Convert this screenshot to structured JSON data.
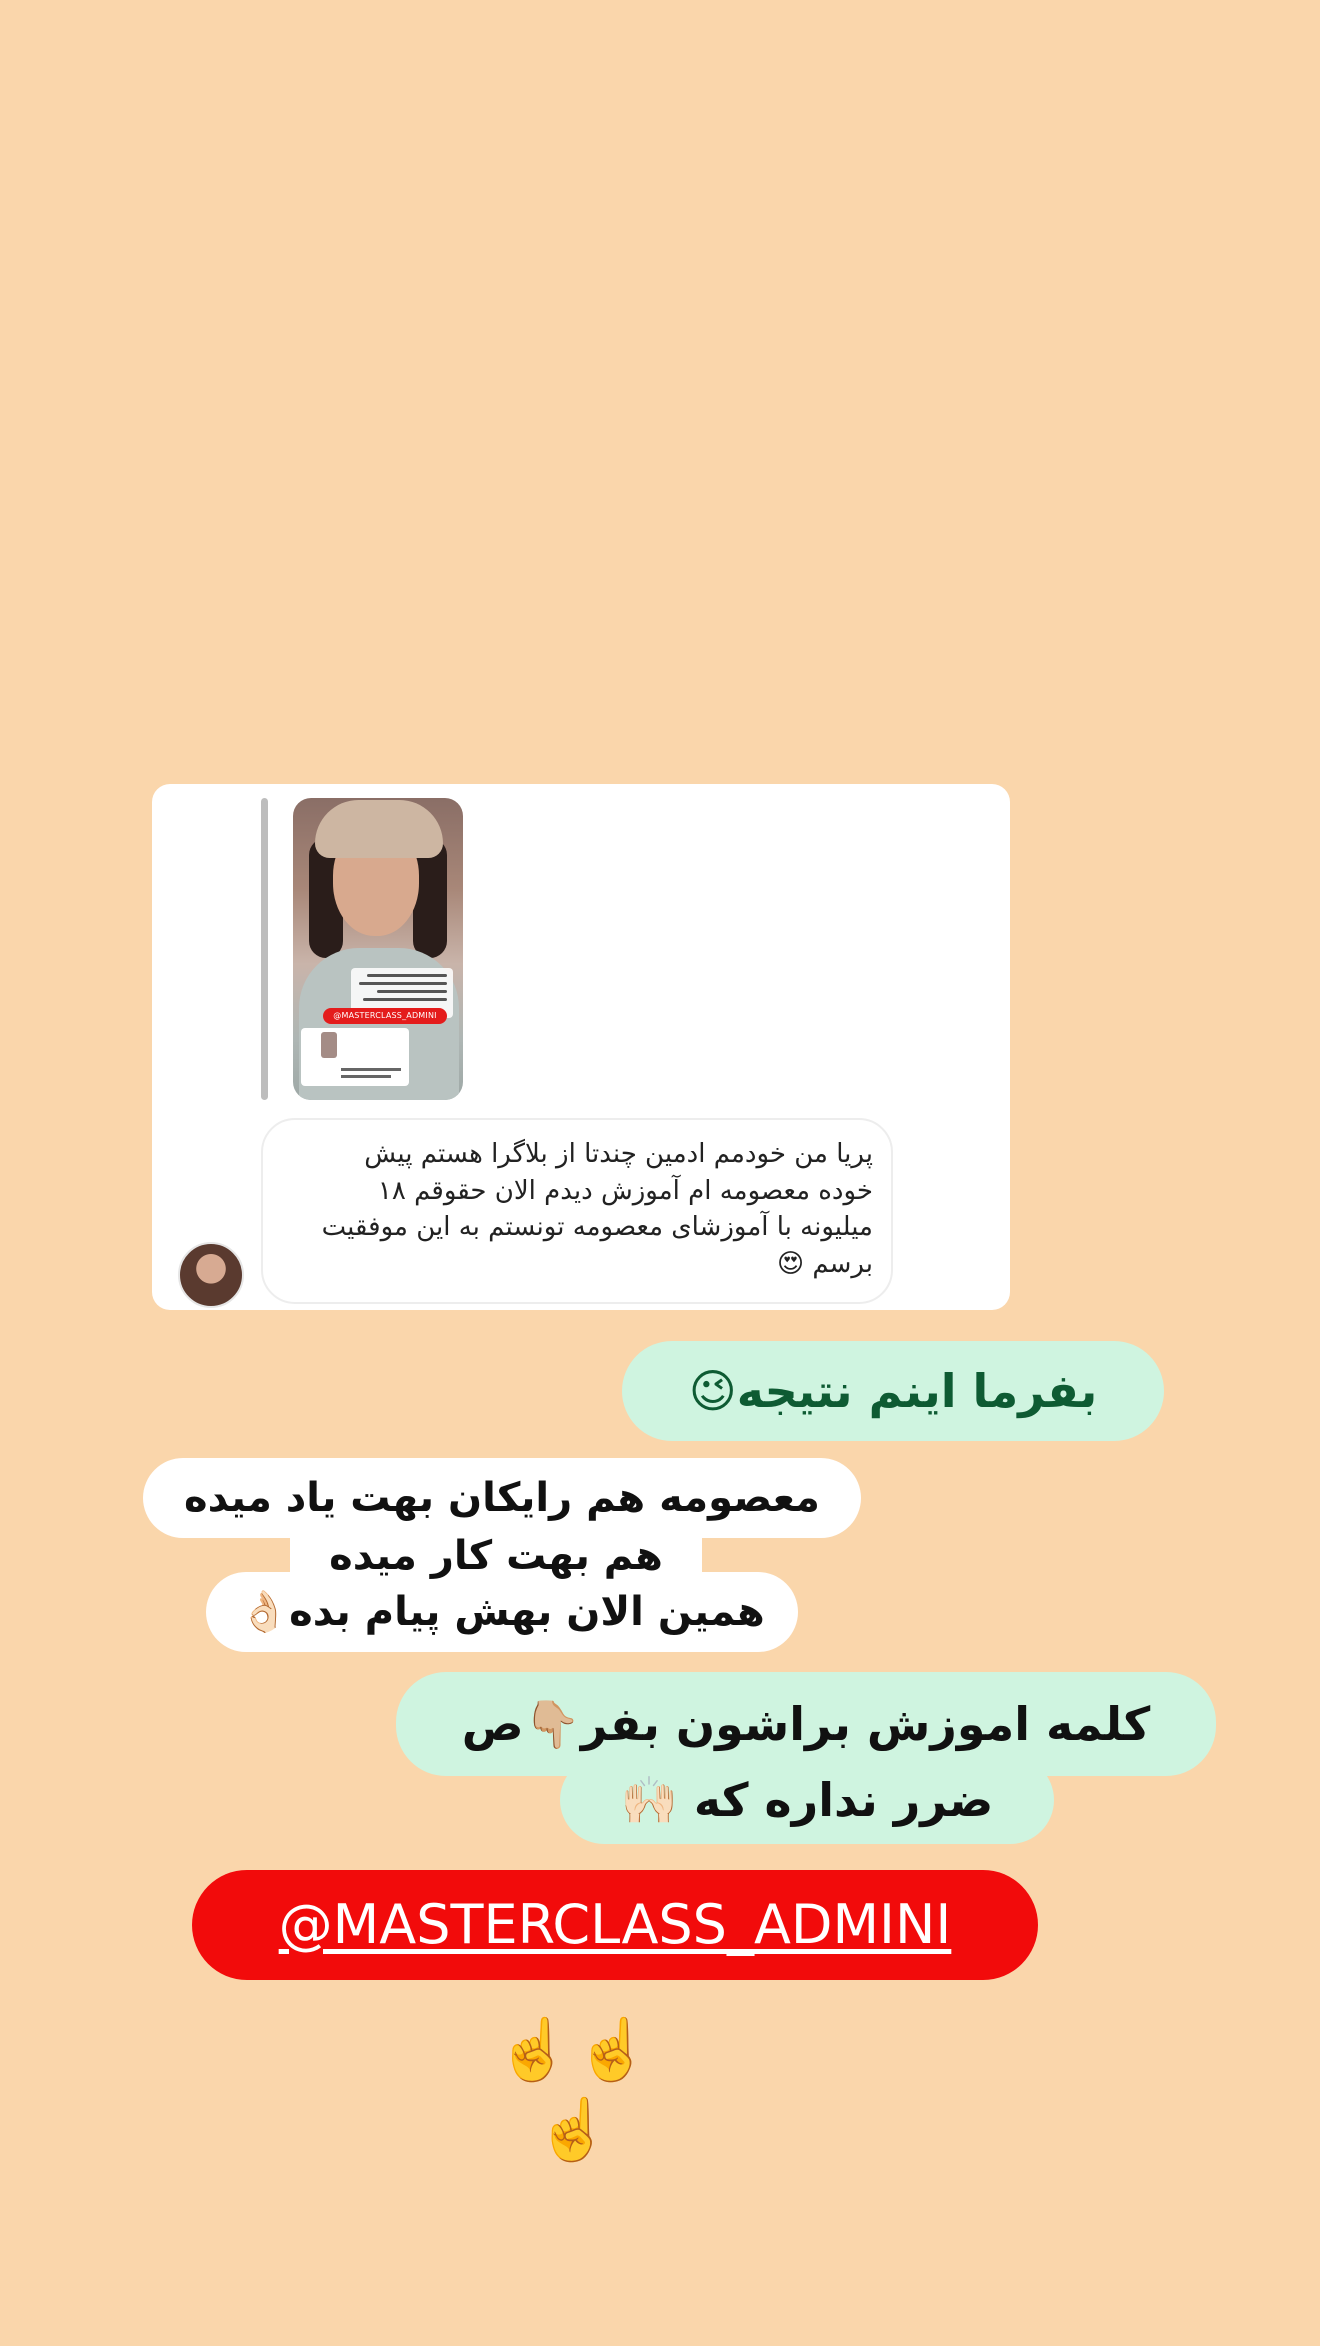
{
  "reply": {
    "comment_text": "پریا من خودمم ادمین چندتا از بلاگرا هستم پیش\nخوده معصومه ام آموزش دیدم الان حقوقم ۱۸\nمیلیونه با آموزشای معصومه تونستم به این موفقیت\nبرسم 😍",
    "thumbnail_tag": "@MASTERCLASS_ADMINI"
  },
  "captions": {
    "result": "بفرما اینم نتیجه😉",
    "teach_line1": "معصومه هم رایکان بهت یاد میده",
    "teach_line2": "هم بهت کار میده",
    "teach_line3": "همین الان بهش پیام بده👌🏻",
    "word_line1": "کلمه اموزش براشون بفر👇🏼ص",
    "word_line2": "ضرر نداره که 🙌🏻"
  },
  "handle": "@MASTERCLASS_ADMINI",
  "pointing": "☝️☝️☝️",
  "colors": {
    "background": "#FAD6AB",
    "mint_caption": "#CFF4E0",
    "handle_red": "#F20B0B",
    "result_text_green": "#0E5B33"
  }
}
